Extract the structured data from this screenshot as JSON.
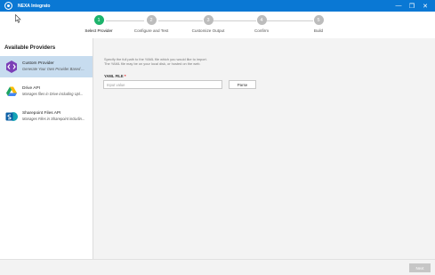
{
  "window": {
    "title": "NEXA Integrato"
  },
  "steps": [
    {
      "num": "1",
      "label": "Select Provider",
      "active": true
    },
    {
      "num": "2",
      "label": "Configure and Test",
      "active": false
    },
    {
      "num": "3",
      "label": "Customize Output",
      "active": false
    },
    {
      "num": "4",
      "label": "Confirm",
      "active": false
    },
    {
      "num": "5",
      "label": "Build",
      "active": false
    }
  ],
  "sidebar": {
    "heading": "Available Providers",
    "providers": [
      {
        "name": "Custom Provider",
        "description": "Generate Your Own Provider Based ...",
        "icon": "custom-provider-icon",
        "color": "#7b3fb7"
      },
      {
        "name": "Drive API",
        "description": "Manages files in Drive including Upl...",
        "icon": "google-drive-icon",
        "color": "#1fa463"
      },
      {
        "name": "Sharepoint Files API",
        "description": "Manages Files in Sharepoint includin...",
        "icon": "sharepoint-icon",
        "color": "#0b7fc7"
      }
    ]
  },
  "main": {
    "instruction_line1": "Specify the full path to the YAML file which you would like to import.",
    "instruction_line2": "The YAML file may be on your local disk, or hosted on the web.",
    "field_label": "YAML FILE",
    "required_mark": "*",
    "input_placeholder": "Input value",
    "input_value": "",
    "parse_label": "Parse"
  },
  "footer": {
    "next_label": "Next"
  }
}
